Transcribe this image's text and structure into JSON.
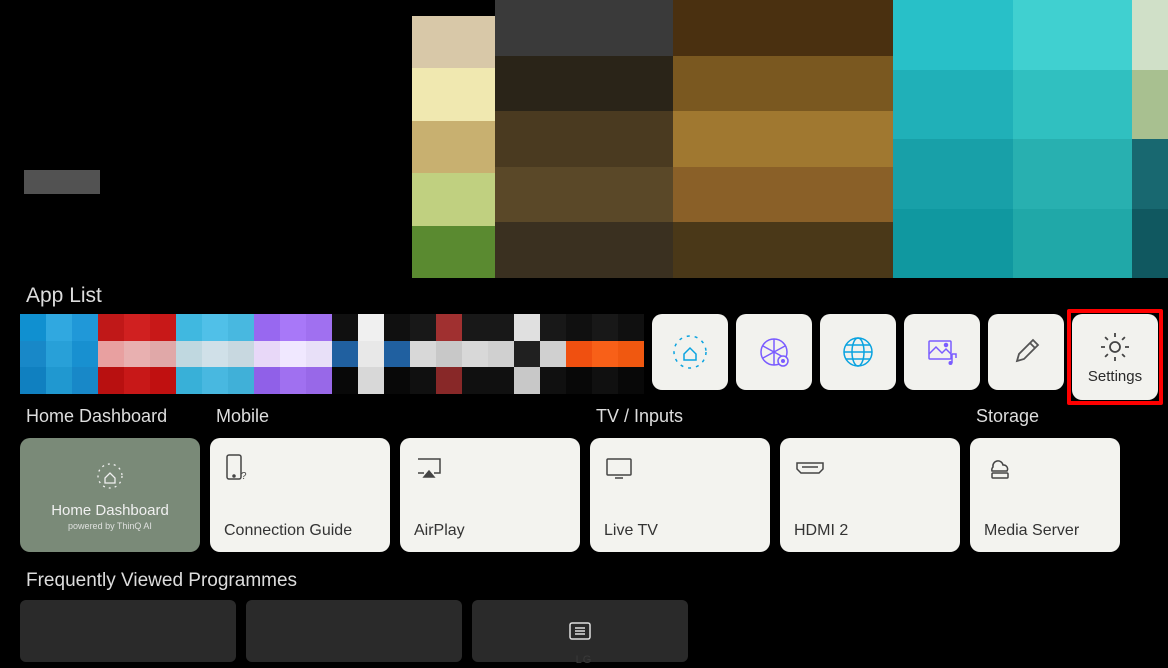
{
  "sections": {
    "app_list_label": "App List",
    "home_dashboard_label": "Home Dashboard",
    "mobile_label": "Mobile",
    "tv_inputs_label": "TV / Inputs",
    "storage_label": "Storage",
    "frequently_viewed_label": "Frequently Viewed Programmes"
  },
  "app_tiles": {
    "settings_label": "Settings"
  },
  "home_dashboard_card": {
    "title": "Home Dashboard",
    "subtitle": "powered by ThinQ AI"
  },
  "dashboard_cards": {
    "connection_guide": "Connection Guide",
    "airplay": "AirPlay",
    "live_tv": "Live TV",
    "hdmi2": "HDMI 2",
    "media_server": "Media Server"
  },
  "branding": "LG",
  "colors": {
    "highlight": "#ff0000",
    "icon_blue": "#0aa3e0",
    "icon_purple": "#7a5cff",
    "card_bg": "#f3f3ef",
    "home_dash_bg": "#7a8a78"
  }
}
